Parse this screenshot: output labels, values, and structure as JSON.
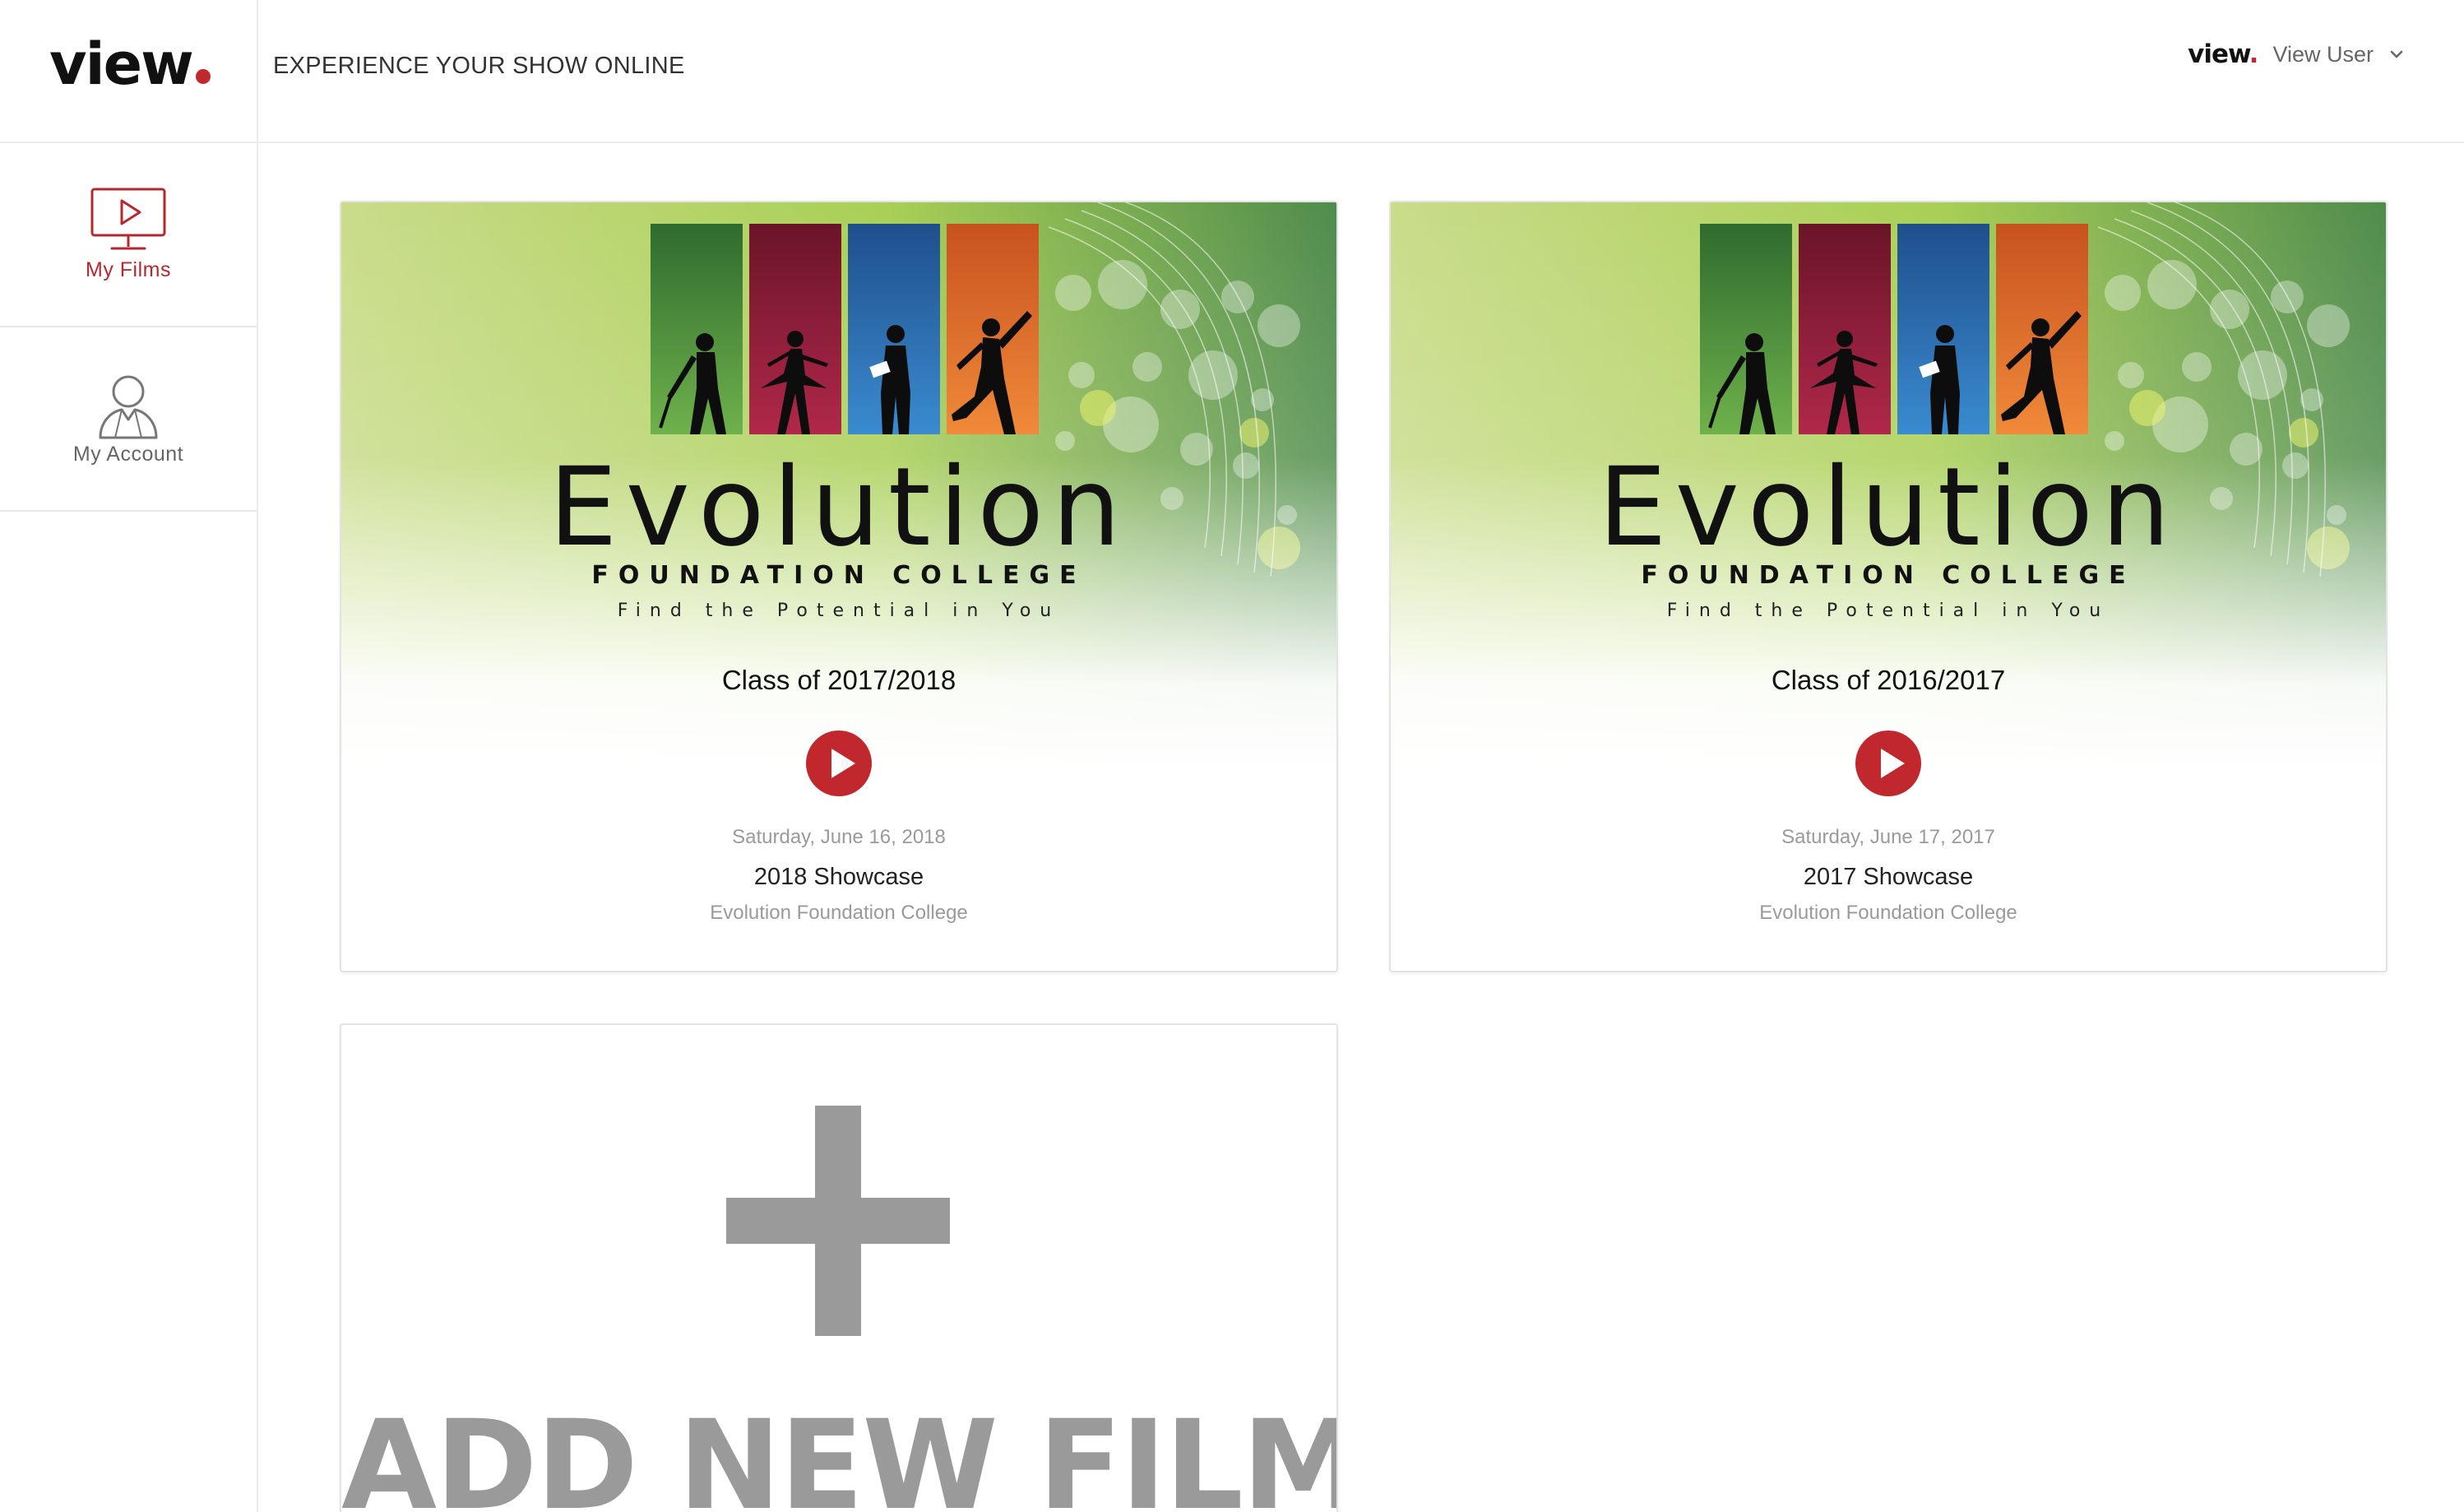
{
  "header": {
    "logo_text": "view",
    "tagline": "EXPERIENCE YOUR SHOW ONLINE",
    "user_menu": {
      "mini_logo": "view",
      "mini_logo_dot": ".",
      "user_name": "View User"
    }
  },
  "sidebar": {
    "items": [
      {
        "label": "My Films",
        "icon": "monitor-play-icon",
        "active": true
      },
      {
        "label": "My Account",
        "icon": "user-icon",
        "active": false
      }
    ]
  },
  "films": [
    {
      "poster_title": "Evolution",
      "poster_subtitle": "FOUNDATION COLLEGE",
      "poster_slogan": "Find the Potential in You",
      "class_label": "Class of 2017/2018",
      "date": "Saturday, June 16, 2018",
      "show_title": "2018 Showcase",
      "organization": "Evolution Foundation College"
    },
    {
      "poster_title": "Evolution",
      "poster_subtitle": "FOUNDATION COLLEGE",
      "poster_slogan": "Find the Potential in You",
      "class_label": "Class of 2016/2017",
      "date": "Saturday, June 17, 2017",
      "show_title": "2017 Showcase",
      "organization": "Evolution Foundation College"
    }
  ],
  "add_film": {
    "label": "ADD NEW FILM",
    "icon": "plus-icon"
  },
  "colors": {
    "brand_red": "#c0282d",
    "panel_green": "#3f8a3a",
    "panel_crimson": "#8e1f38",
    "panel_blue": "#2f6fae",
    "panel_orange": "#e0712c",
    "muted_grey": "#9a9a9a"
  }
}
